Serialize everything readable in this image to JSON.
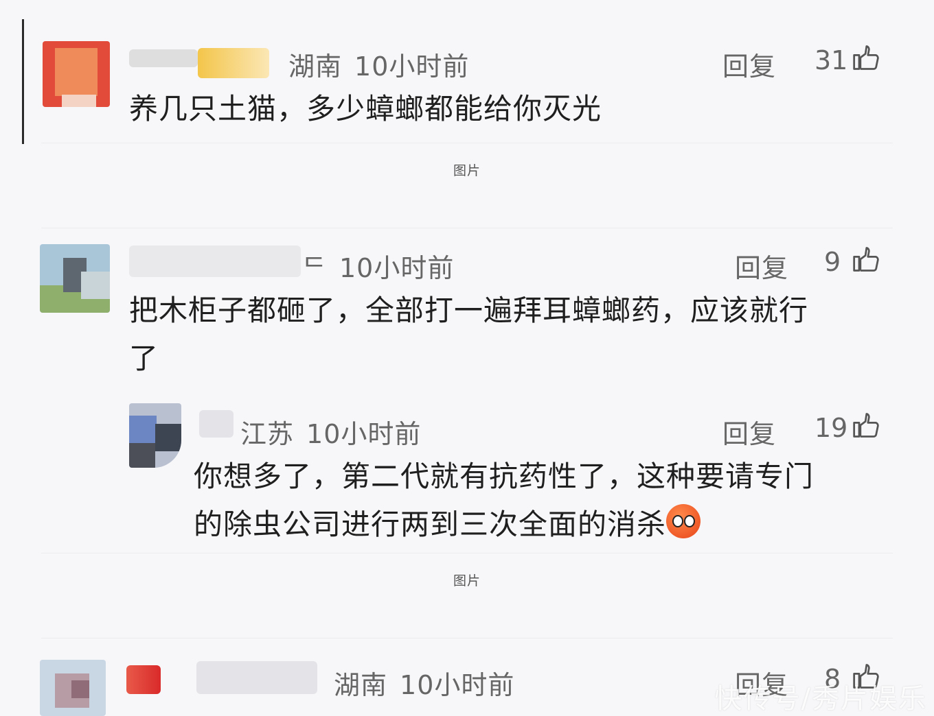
{
  "comments": [
    {
      "location": "湖南",
      "time": "10小时前",
      "reply_label": "回复",
      "like_count": "31",
      "text": "养几只土猫，多少蟑螂都能给你灭光"
    },
    {
      "location_partial": "ᄃ",
      "time": "10小时前",
      "reply_label": "回复",
      "like_count": "9",
      "text_line1": "把木柜子都砸了，全部打一遍拜耳蟑螂药，应该就行",
      "text_line2": "了"
    },
    {
      "location": "江苏",
      "time": "10小时前",
      "reply_label": "回复",
      "like_count": "19",
      "text_line1": "你想多了，第二代就有抗药性了，这种要请专门",
      "text_line2": "的除虫公司进行两到三次全面的消杀"
    },
    {
      "location": "湖南",
      "time": "10小时前",
      "reply_label": "回复",
      "like_count": "8"
    }
  ],
  "image_caption_1": "图片",
  "image_caption_2": "图片",
  "watermark": "快传号/秀片娱乐",
  "icons": {
    "like": "thumbs-up-icon",
    "emoji": "shocked-face-emoji-icon"
  },
  "colors": {
    "background": "#f7f7f9",
    "meta_text": "#666666",
    "body_text": "#1f1f1f"
  }
}
